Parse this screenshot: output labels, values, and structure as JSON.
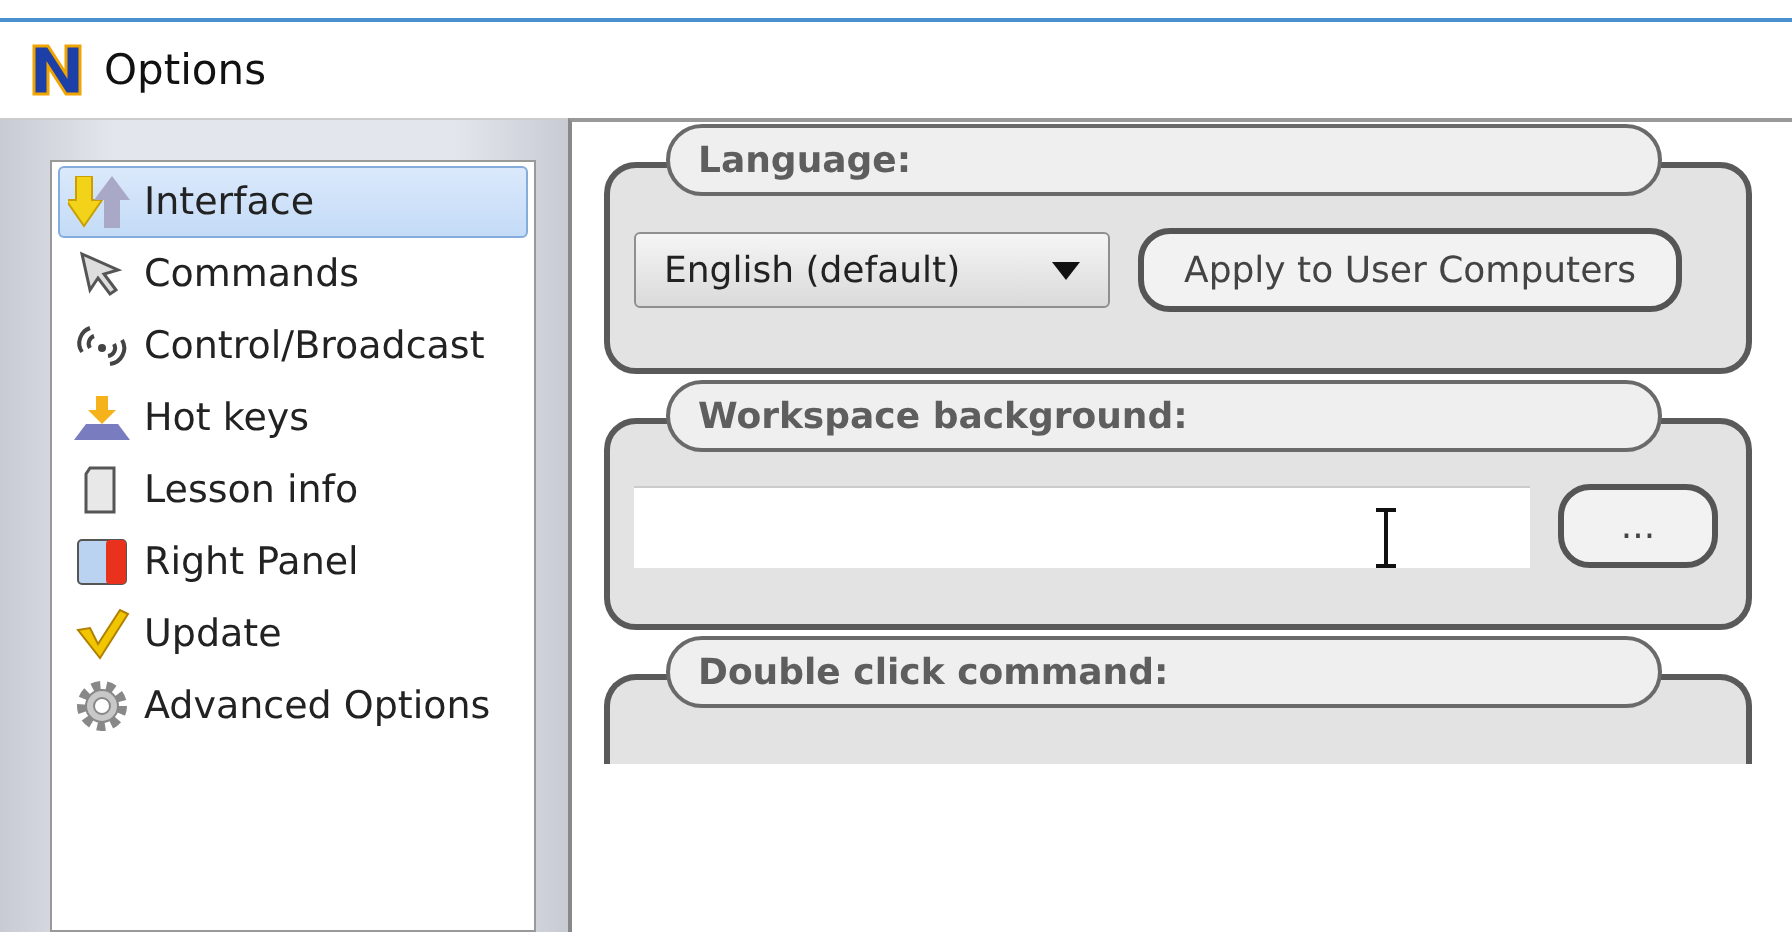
{
  "window": {
    "title": "Options"
  },
  "sidebar": {
    "items": [
      {
        "label": "Interface",
        "selected": true
      },
      {
        "label": "Commands",
        "selected": false
      },
      {
        "label": "Control/Broadcast",
        "selected": false
      },
      {
        "label": "Hot keys",
        "selected": false
      },
      {
        "label": "Lesson info",
        "selected": false
      },
      {
        "label": "Right Panel",
        "selected": false
      },
      {
        "label": "Update",
        "selected": false
      },
      {
        "label": "Advanced Options",
        "selected": false
      }
    ]
  },
  "groups": [
    {
      "kind": "dropdown",
      "title": "Language:",
      "value": "English (default)",
      "button": "Apply to User Computers"
    },
    {
      "kind": "file",
      "title": "Workspace background:",
      "button": "..."
    },
    {
      "kind": "header",
      "title": "Double click command:"
    }
  ]
}
